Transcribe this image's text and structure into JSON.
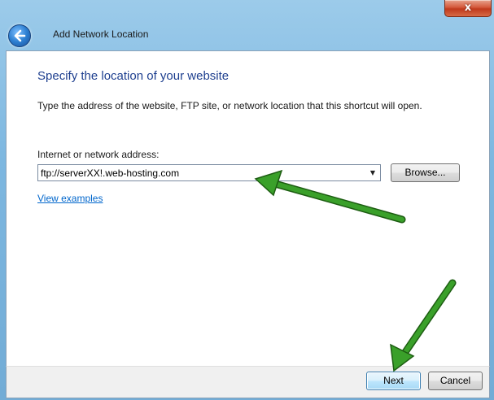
{
  "window": {
    "title": "Add Network Location",
    "close_label": "x"
  },
  "main": {
    "heading": "Specify the location of your website",
    "description": "Type the address of the website, FTP site, or network location that this shortcut will open.",
    "address_label": "Internet or network address:",
    "address_value": "ftp://serverXX!.web-hosting.com",
    "browse_label": "Browse...",
    "examples_link": "View examples"
  },
  "footer": {
    "next_label": "Next",
    "cancel_label": "Cancel"
  },
  "colors": {
    "accent_arrow": "#2e8b1e",
    "heading": "#1e3f8f",
    "link": "#0066cc"
  },
  "icons": [
    "back-arrow-icon",
    "close-icon",
    "dropdown-arrow-icon"
  ]
}
